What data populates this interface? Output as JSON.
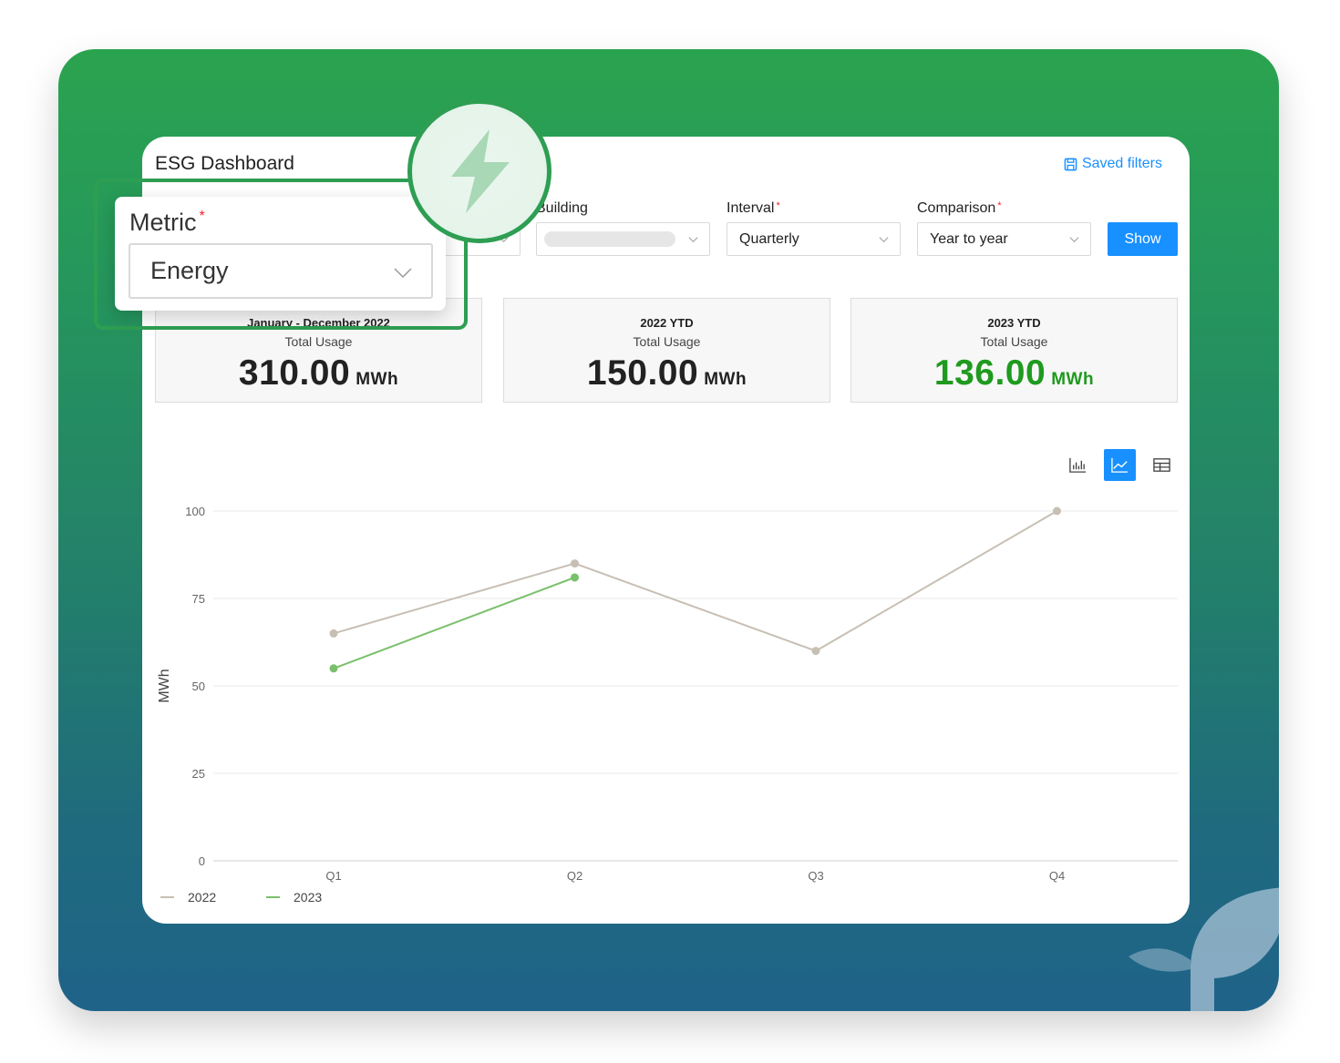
{
  "header": {
    "title": "ESG Dashboard",
    "saved_filters": "Saved filters"
  },
  "filters": {
    "building_label": "Building",
    "interval_label": "Interval",
    "interval_value": "Quarterly",
    "comparison_label": "Comparison",
    "comparison_value": "Year to year",
    "required_mark": "*",
    "show_button": "Show"
  },
  "metric": {
    "label": "Metric",
    "value": "Energy"
  },
  "stats": [
    {
      "period": "January - December 2022",
      "label": "Total Usage",
      "value": "310.00",
      "unit": "MWh"
    },
    {
      "period": "2022 YTD",
      "label": "Total Usage",
      "value": "150.00",
      "unit": "MWh"
    },
    {
      "period": "2023 YTD",
      "label": "Total Usage",
      "value": "136.00",
      "unit": "MWh",
      "highlight_color": "#1f9a1f"
    }
  ],
  "view_toggles": [
    {
      "icon": "bar-chart-icon",
      "active": false
    },
    {
      "icon": "line-chart-icon",
      "active": true
    },
    {
      "icon": "table-icon",
      "active": false
    }
  ],
  "colors": {
    "accent": "#1890ff",
    "brand_green": "#2e9e52",
    "series_2022": "#c8bfb4",
    "series_2023": "#79c06a"
  },
  "chart_data": {
    "type": "line",
    "categories": [
      "Q1",
      "Q2",
      "Q3",
      "Q4"
    ],
    "ylabel": "MWh",
    "ylim": [
      0,
      100
    ],
    "yticks": [
      0,
      25,
      50,
      75,
      100
    ],
    "grid": true,
    "legend": "bottom-left",
    "series": [
      {
        "name": "2022",
        "color": "#c8bfb4",
        "values": [
          65,
          85,
          60,
          100
        ]
      },
      {
        "name": "2023",
        "color": "#79c06a",
        "values": [
          55,
          81,
          null,
          null
        ]
      }
    ]
  }
}
